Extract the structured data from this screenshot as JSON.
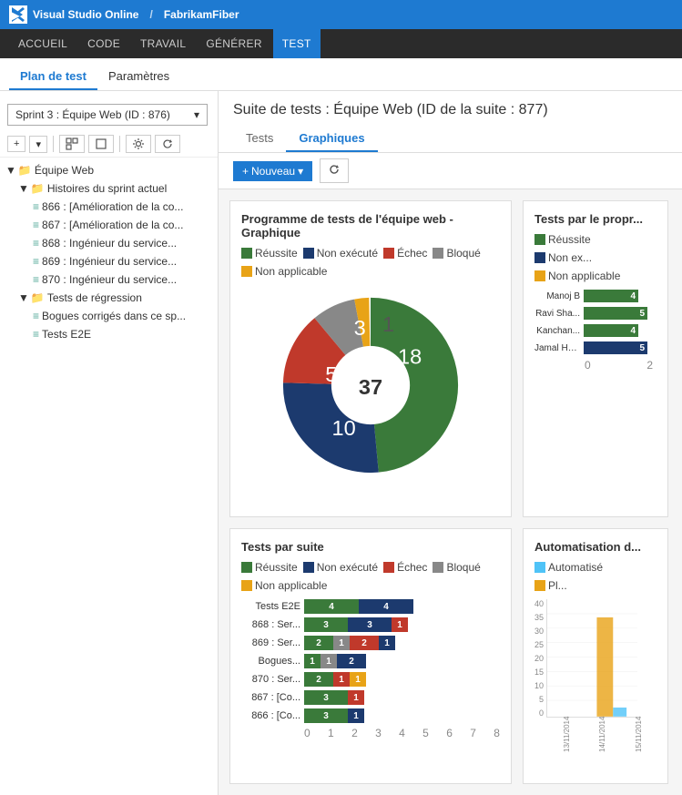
{
  "topbar": {
    "logo_text": "VS",
    "brand": "Visual Studio Online",
    "sep": "/",
    "project": "FabrikamFiber"
  },
  "navbar": {
    "items": [
      {
        "label": "ACCUEIL",
        "active": false
      },
      {
        "label": "CODE",
        "active": false
      },
      {
        "label": "TRAVAIL",
        "active": false
      },
      {
        "label": "GÉNÉRER",
        "active": false
      },
      {
        "label": "TEST",
        "active": true
      }
    ]
  },
  "subnav": {
    "items": [
      {
        "label": "Plan de test",
        "active": true
      },
      {
        "label": "Paramètres",
        "active": false
      }
    ]
  },
  "sidebar": {
    "dropdown_label": "Sprint 3 : Équipe Web (ID : 876)",
    "toolbar_buttons": [
      "+",
      "▾",
      "□+",
      "□-",
      "⚙",
      "↺"
    ],
    "tree": [
      {
        "label": "Équipe Web",
        "level": 0,
        "type": "folder",
        "expanded": true
      },
      {
        "label": "Histoires du sprint actuel",
        "level": 1,
        "type": "folder",
        "expanded": true
      },
      {
        "label": "866 : [Amélioration de la co...",
        "level": 2,
        "type": "file"
      },
      {
        "label": "867 : [Amélioration de la co...",
        "level": 2,
        "type": "file"
      },
      {
        "label": "868 : Ingénieur du service...",
        "level": 2,
        "type": "file"
      },
      {
        "label": "869 : Ingénieur du service...",
        "level": 2,
        "type": "file"
      },
      {
        "label": "870 : Ingénieur du service...",
        "level": 2,
        "type": "file"
      },
      {
        "label": "Tests de régression",
        "level": 1,
        "type": "folder",
        "expanded": true
      },
      {
        "label": "Bogues corrigés dans ce sp...",
        "level": 2,
        "type": "file"
      },
      {
        "label": "Tests E2E",
        "level": 2,
        "type": "file"
      }
    ]
  },
  "content": {
    "title": "Suite de tests : Équipe Web (ID de la suite : 877)",
    "tabs": [
      {
        "label": "Tests",
        "active": false
      },
      {
        "label": "Graphiques",
        "active": true
      }
    ],
    "toolbar": {
      "new_btn": "+ Nouveau",
      "new_dropdown": "▾",
      "refresh_btn": "↺"
    }
  },
  "donut_chart": {
    "title": "Programme de tests de l'équipe web - Graphique",
    "center_value": "37",
    "legend": [
      {
        "label": "Réussite",
        "color": "#3a7a3a"
      },
      {
        "label": "Non exécuté",
        "color": "#1c3a6e"
      },
      {
        "label": "Échec",
        "color": "#c0392b"
      },
      {
        "label": "Bloqué",
        "color": "#888"
      },
      {
        "label": "Non applicable",
        "color": "#e8a317"
      }
    ],
    "segments": [
      {
        "value": 18,
        "label": "18",
        "color": "#3a7a3a",
        "percent": 48.6
      },
      {
        "value": 10,
        "label": "10",
        "color": "#1c3a6e",
        "percent": 27.0
      },
      {
        "value": 5,
        "label": "5",
        "color": "#c0392b",
        "percent": 13.5
      },
      {
        "value": 3,
        "label": "3",
        "color": "#888888",
        "percent": 8.1
      },
      {
        "value": 1,
        "label": "1",
        "color": "#e8a317",
        "percent": 2.7
      }
    ]
  },
  "bar_chart": {
    "title": "Tests par suite",
    "legend": [
      {
        "label": "Réussite",
        "color": "#3a7a3a"
      },
      {
        "label": "Non exécuté",
        "color": "#1c3a6e"
      },
      {
        "label": "Échec",
        "color": "#c0392b"
      },
      {
        "label": "Bloqué",
        "color": "#888"
      },
      {
        "label": "Non applicable",
        "color": "#e8a317"
      }
    ],
    "rows": [
      {
        "label": "Tests E2E",
        "segments": [
          {
            "val": 4,
            "color": "#3a7a3a"
          },
          {
            "val": 4,
            "color": "#1c3a6e"
          }
        ]
      },
      {
        "label": "868 : Ser...",
        "segments": [
          {
            "val": 3,
            "color": "#3a7a3a"
          },
          {
            "val": 3,
            "color": "#1c3a6e"
          },
          {
            "val": 1,
            "color": "#c0392b"
          }
        ]
      },
      {
        "label": "869 : Ser...",
        "segments": [
          {
            "val": 2,
            "color": "#3a7a3a"
          },
          {
            "val": 1,
            "color": "#888888"
          },
          {
            "val": 2,
            "color": "#c0392b"
          },
          {
            "val": 1,
            "color": "#1c3a6e"
          }
        ]
      },
      {
        "label": "Bogues...",
        "segments": [
          {
            "val": 1,
            "color": "#3a7a3a"
          },
          {
            "val": 1,
            "color": "#888888"
          },
          {
            "val": 2,
            "color": "#1c3a6e"
          }
        ]
      },
      {
        "label": "870 : Ser...",
        "segments": [
          {
            "val": 2,
            "color": "#3a7a3a"
          },
          {
            "val": 1,
            "color": "#c0392b"
          },
          {
            "val": 1,
            "color": "#e8a317"
          }
        ]
      },
      {
        "label": "867 : [Co...",
        "segments": [
          {
            "val": 3,
            "color": "#3a7a3a"
          },
          {
            "val": 1,
            "color": "#c0392b"
          }
        ]
      },
      {
        "label": "866 : [Co...",
        "segments": [
          {
            "val": 3,
            "color": "#3a7a3a"
          },
          {
            "val": 1,
            "color": "#1c3a6e"
          }
        ]
      }
    ],
    "axis_labels": [
      "0",
      "1",
      "2",
      "3",
      "4",
      "5",
      "6",
      "7",
      "8"
    ]
  },
  "ownership_chart": {
    "title": "Tests par le propr...",
    "legend": [
      {
        "label": "Réussite",
        "color": "#3a7a3a"
      },
      {
        "label": "Non ex...",
        "color": "#1c3a6e"
      },
      {
        "label": "Non applicable",
        "color": "#e8a317"
      }
    ],
    "rows": [
      {
        "label": "Manoj B",
        "val": 4,
        "color": "#3a7a3a"
      },
      {
        "label": "Ravi Sha...",
        "val": 5,
        "color": "#3a7a3a"
      },
      {
        "label": "Kanchan...",
        "val": 4,
        "color": "#3a7a3a"
      },
      {
        "label": "Jamal Ha...",
        "val": 5,
        "color": "#1c3a6e"
      }
    ],
    "axis_labels": [
      "0",
      "2"
    ]
  },
  "automation_chart": {
    "title": "Automatisation d...",
    "legend": [
      {
        "label": "Automatisé",
        "color": "#4fc3f7"
      },
      {
        "label": "Pl...",
        "color": "#e8a317"
      }
    ],
    "y_labels": [
      "40",
      "35",
      "30",
      "25",
      "20",
      "15",
      "10",
      "5",
      "0"
    ],
    "x_labels": [
      "13/11/2014",
      "14/11/2014",
      "15/11/2014"
    ]
  }
}
